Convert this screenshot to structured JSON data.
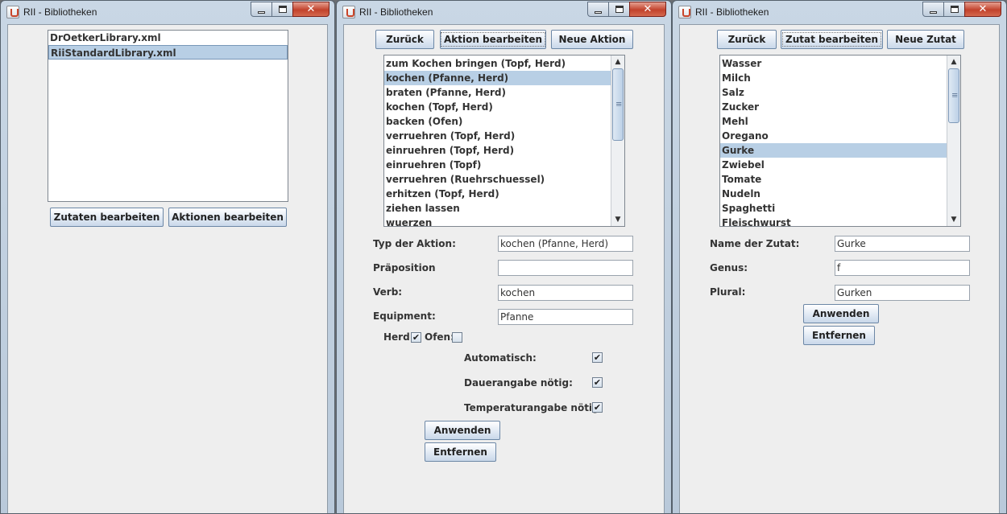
{
  "window_title": "RII - Bibliotheken",
  "win1": {
    "files": [
      "DrOetkerLibrary.xml",
      "RiiStandardLibrary.xml"
    ],
    "btn_zutaten": "Zutaten bearbeiten",
    "btn_aktionen": "Aktionen bearbeiten"
  },
  "win2": {
    "btn_back": "Zurück",
    "btn_edit": "Aktion bearbeiten",
    "btn_new": "Neue Aktion",
    "actions": [
      "zum Kochen bringen (Topf, Herd)",
      "kochen (Pfanne, Herd)",
      "braten (Pfanne, Herd)",
      "kochen (Topf, Herd)",
      "backen (Ofen)",
      "verruehren (Topf, Herd)",
      "einruehren (Topf, Herd)",
      "einruehren (Topf)",
      "verruehren (Ruehrschuessel)",
      "erhitzen (Topf, Herd)",
      "ziehen lassen",
      "wuerzen"
    ],
    "selected_index": 1,
    "label_typ": "Typ der Aktion:",
    "value_typ": "kochen (Pfanne, Herd)",
    "label_prep": "Präposition",
    "value_prep": "",
    "label_verb": "Verb:",
    "value_verb": "kochen",
    "label_equip": "Equipment:",
    "value_equip": "Pfanne",
    "label_herd": "Herd:",
    "label_ofen": "Ofen:",
    "label_auto": "Automatisch:",
    "label_dauer": "Dauerangabe nötig:",
    "label_temp": "Temperaturangabe nötig:",
    "btn_apply": "Anwenden",
    "btn_remove": "Entfernen"
  },
  "win3": {
    "btn_back": "Zurück",
    "btn_edit": "Zutat bearbeiten",
    "btn_new": "Neue Zutat",
    "ingredients": [
      "Wasser",
      "Milch",
      "Salz",
      "Zucker",
      "Mehl",
      "Oregano",
      "Gurke",
      "Zwiebel",
      "Tomate",
      "Nudeln",
      "Spaghetti",
      "Fleischwurst"
    ],
    "selected_index": 6,
    "label_name": "Name der Zutat:",
    "value_name": "Gurke",
    "label_genus": "Genus:",
    "value_genus": "f",
    "label_plural": "Plural:",
    "value_plural": "Gurken",
    "btn_apply": "Anwenden",
    "btn_remove": "Entfernen"
  },
  "checkmark": "✔"
}
